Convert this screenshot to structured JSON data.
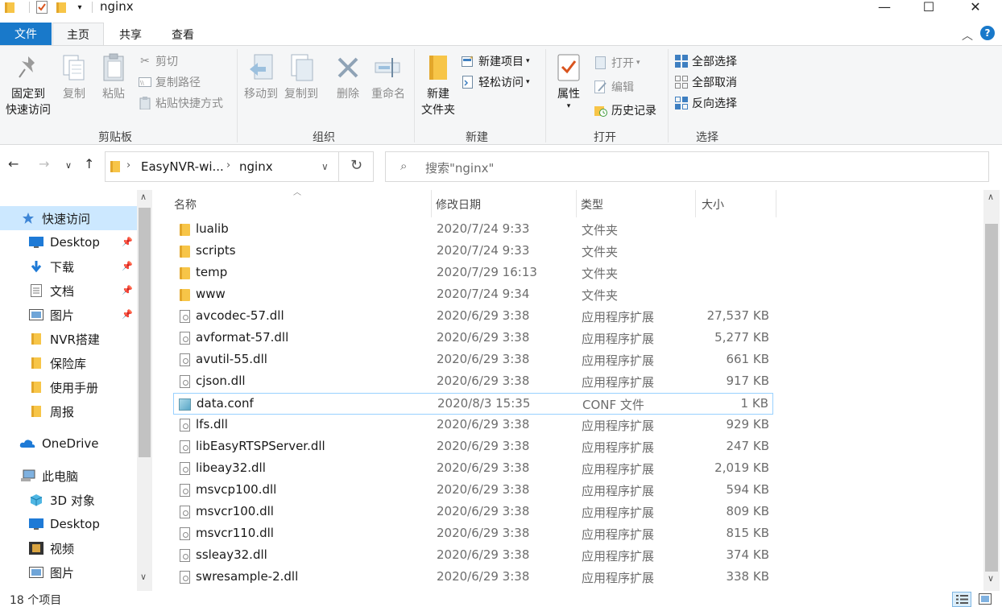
{
  "window": {
    "title": "nginx",
    "minimize": "—",
    "maximize": "☐",
    "close": "✕"
  },
  "ribbon_tabs": [
    "文件",
    "主页",
    "共享",
    "查看"
  ],
  "ribbon": {
    "clipboard": {
      "pin_line1": "固定到",
      "pin_line2": "快速访问",
      "copy": "复制",
      "paste": "粘贴",
      "cut": "剪切",
      "copy_path": "复制路径",
      "paste_shortcut": "粘贴快捷方式",
      "label": "剪贴板"
    },
    "organize": {
      "move_to": "移动到",
      "copy_to": "复制到",
      "delete": "删除",
      "rename": "重命名",
      "label": "组织"
    },
    "new": {
      "new_folder_line1": "新建",
      "new_folder_line2": "文件夹",
      "new_item": "新建项目",
      "easy_access": "轻松访问",
      "label": "新建"
    },
    "open": {
      "properties": "属性",
      "open": "打开",
      "edit": "编辑",
      "history": "历史记录",
      "label": "打开"
    },
    "select": {
      "select_all": "全部选择",
      "select_none": "全部取消",
      "invert": "反向选择",
      "label": "选择"
    }
  },
  "address": {
    "crumbs": [
      "EasyNVR-wi...",
      "nginx"
    ],
    "search_placeholder": "搜索\"nginx\""
  },
  "nav_pane": [
    {
      "label": "快速访问",
      "icon": "star-icon",
      "selected": true
    },
    {
      "label": "Desktop",
      "icon": "desktop-icon",
      "pinned": true
    },
    {
      "label": "下载",
      "icon": "download-icon",
      "pinned": true
    },
    {
      "label": "文档",
      "icon": "document-icon",
      "pinned": true
    },
    {
      "label": "图片",
      "icon": "picture-icon",
      "pinned": true
    },
    {
      "label": "NVR搭建",
      "icon": "folder-icon"
    },
    {
      "label": "保险库",
      "icon": "folder-icon"
    },
    {
      "label": "使用手册",
      "icon": "folder-icon"
    },
    {
      "label": "周报",
      "icon": "folder-icon"
    },
    {
      "label": "OneDrive",
      "icon": "cloud-icon"
    },
    {
      "label": "此电脑",
      "icon": "computer-icon"
    },
    {
      "label": "3D 对象",
      "icon": "cube-icon"
    },
    {
      "label": "Desktop",
      "icon": "desktop-icon"
    },
    {
      "label": "视频",
      "icon": "video-icon"
    },
    {
      "label": "图片",
      "icon": "picture-icon"
    }
  ],
  "columns": {
    "name": "名称",
    "date": "修改日期",
    "type": "类型",
    "size": "大小"
  },
  "files": [
    {
      "name": "lualib",
      "date": "2020/7/24 9:33",
      "type": "文件夹",
      "size": "",
      "kind": "folder"
    },
    {
      "name": "scripts",
      "date": "2020/7/24 9:33",
      "type": "文件夹",
      "size": "",
      "kind": "folder"
    },
    {
      "name": "temp",
      "date": "2020/7/29 16:13",
      "type": "文件夹",
      "size": "",
      "kind": "folder"
    },
    {
      "name": "www",
      "date": "2020/7/24 9:34",
      "type": "文件夹",
      "size": "",
      "kind": "folder"
    },
    {
      "name": "avcodec-57.dll",
      "date": "2020/6/29 3:38",
      "type": "应用程序扩展",
      "size": "27,537 KB",
      "kind": "dll"
    },
    {
      "name": "avformat-57.dll",
      "date": "2020/6/29 3:38",
      "type": "应用程序扩展",
      "size": "5,277 KB",
      "kind": "dll"
    },
    {
      "name": "avutil-55.dll",
      "date": "2020/6/29 3:38",
      "type": "应用程序扩展",
      "size": "661 KB",
      "kind": "dll"
    },
    {
      "name": "cjson.dll",
      "date": "2020/6/29 3:38",
      "type": "应用程序扩展",
      "size": "917 KB",
      "kind": "dll"
    },
    {
      "name": "data.conf",
      "date": "2020/8/3 15:35",
      "type": "CONF 文件",
      "size": "1 KB",
      "kind": "conf",
      "focused": true
    },
    {
      "name": "lfs.dll",
      "date": "2020/6/29 3:38",
      "type": "应用程序扩展",
      "size": "929 KB",
      "kind": "dll"
    },
    {
      "name": "libEasyRTSPServer.dll",
      "date": "2020/6/29 3:38",
      "type": "应用程序扩展",
      "size": "247 KB",
      "kind": "dll"
    },
    {
      "name": "libeay32.dll",
      "date": "2020/6/29 3:38",
      "type": "应用程序扩展",
      "size": "2,019 KB",
      "kind": "dll"
    },
    {
      "name": "msvcp100.dll",
      "date": "2020/6/29 3:38",
      "type": "应用程序扩展",
      "size": "594 KB",
      "kind": "dll"
    },
    {
      "name": "msvcr100.dll",
      "date": "2020/6/29 3:38",
      "type": "应用程序扩展",
      "size": "809 KB",
      "kind": "dll"
    },
    {
      "name": "msvcr110.dll",
      "date": "2020/6/29 3:38",
      "type": "应用程序扩展",
      "size": "815 KB",
      "kind": "dll"
    },
    {
      "name": "ssleay32.dll",
      "date": "2020/6/29 3:38",
      "type": "应用程序扩展",
      "size": "374 KB",
      "kind": "dll"
    },
    {
      "name": "swresample-2.dll",
      "date": "2020/6/29 3:38",
      "type": "应用程序扩展",
      "size": "338 KB",
      "kind": "dll"
    }
  ],
  "status": {
    "count": "18 个项目"
  },
  "colors": {
    "accent": "#1979ca",
    "selected_bg": "#cce8ff",
    "focus_border": "#99d1ff"
  }
}
